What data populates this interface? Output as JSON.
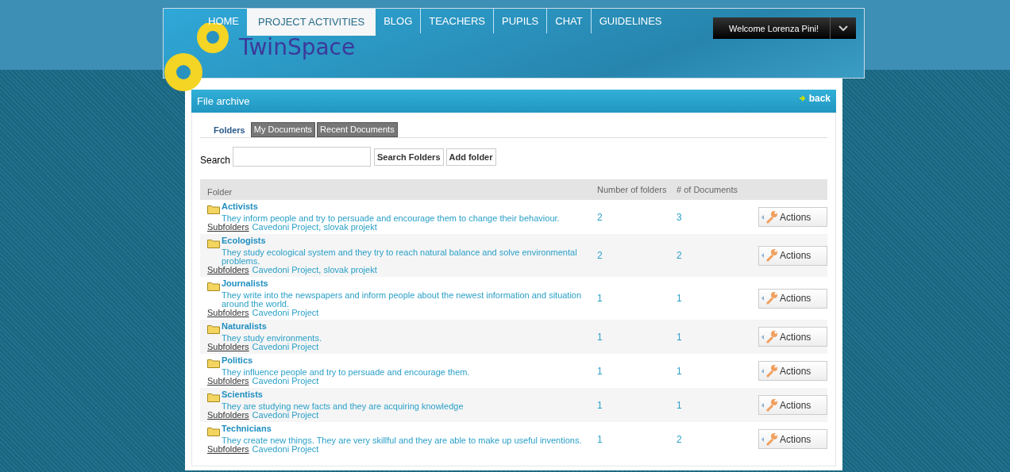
{
  "header": {
    "logo": "TwinSpace",
    "nav": [
      {
        "label": "HOME",
        "selected": false
      },
      {
        "label": "PROJECT ACTIVITIES",
        "selected": true
      },
      {
        "label": "BLOG",
        "selected": false
      },
      {
        "label": "TEACHERS",
        "selected": false
      },
      {
        "label": "PUPILS",
        "selected": false
      },
      {
        "label": "CHAT",
        "selected": false
      },
      {
        "label": "GUIDELINES",
        "selected": false
      }
    ],
    "welcome": "Welcome Lorenza Pini!"
  },
  "panel": {
    "title": "File archive",
    "back": "back"
  },
  "tabs": [
    {
      "label": "Folders",
      "selected": true
    },
    {
      "label": "My Documents",
      "selected": false
    },
    {
      "label": "Recent Documents",
      "selected": false
    }
  ],
  "search": {
    "label": "Search",
    "buttons": [
      "Search Folders",
      "Add folder"
    ]
  },
  "table": {
    "columns": [
      "Folder",
      "Number of folders",
      "# of Documents"
    ],
    "rows": [
      {
        "name": "Activists",
        "description": "They inform people and try to persuade and encourage them to change their behaviour.",
        "subfolders_label": "Subfolders",
        "subfolders": "Cavedoni Project, slovak projekt",
        "folders": "2",
        "documents": "3",
        "action": "Actions"
      },
      {
        "name": "Ecologists",
        "description": "They study ecological system and they try to reach natural balance and solve environmental problems.",
        "subfolders_label": "Subfolders",
        "subfolders": "Cavedoni Project, slovak projekt",
        "folders": "2",
        "documents": "2",
        "action": "Actions"
      },
      {
        "name": "Journalists",
        "description": "They write into the newspapers and inform people about the newest information and situation around the world.",
        "subfolders_label": "Subfolders",
        "subfolders": "Cavedoni Project",
        "folders": "1",
        "documents": "1",
        "action": "Actions"
      },
      {
        "name": "Naturalists",
        "description": "They study environments.",
        "subfolders_label": "Subfolders",
        "subfolders": "Cavedoni Project",
        "folders": "1",
        "documents": "1",
        "action": "Actions"
      },
      {
        "name": "Politics",
        "description": "They influence people and try to persuade and encourage them.",
        "subfolders_label": "Subfolders",
        "subfolders": "Cavedoni Project",
        "folders": "1",
        "documents": "1",
        "action": "Actions"
      },
      {
        "name": "Scientists",
        "description": "They are studying new facts and they are acquiring knowledge",
        "subfolders_label": "Subfolders",
        "subfolders": "Cavedoni Project",
        "folders": "1",
        "documents": "1",
        "action": "Actions"
      },
      {
        "name": "Technicians",
        "description": "They create new things. They are very skillful and they are able to make up useful inventions.",
        "subfolders_label": "Subfolders",
        "subfolders": "Cavedoni Project",
        "folders": "1",
        "documents": "2",
        "action": "Actions"
      }
    ]
  }
}
